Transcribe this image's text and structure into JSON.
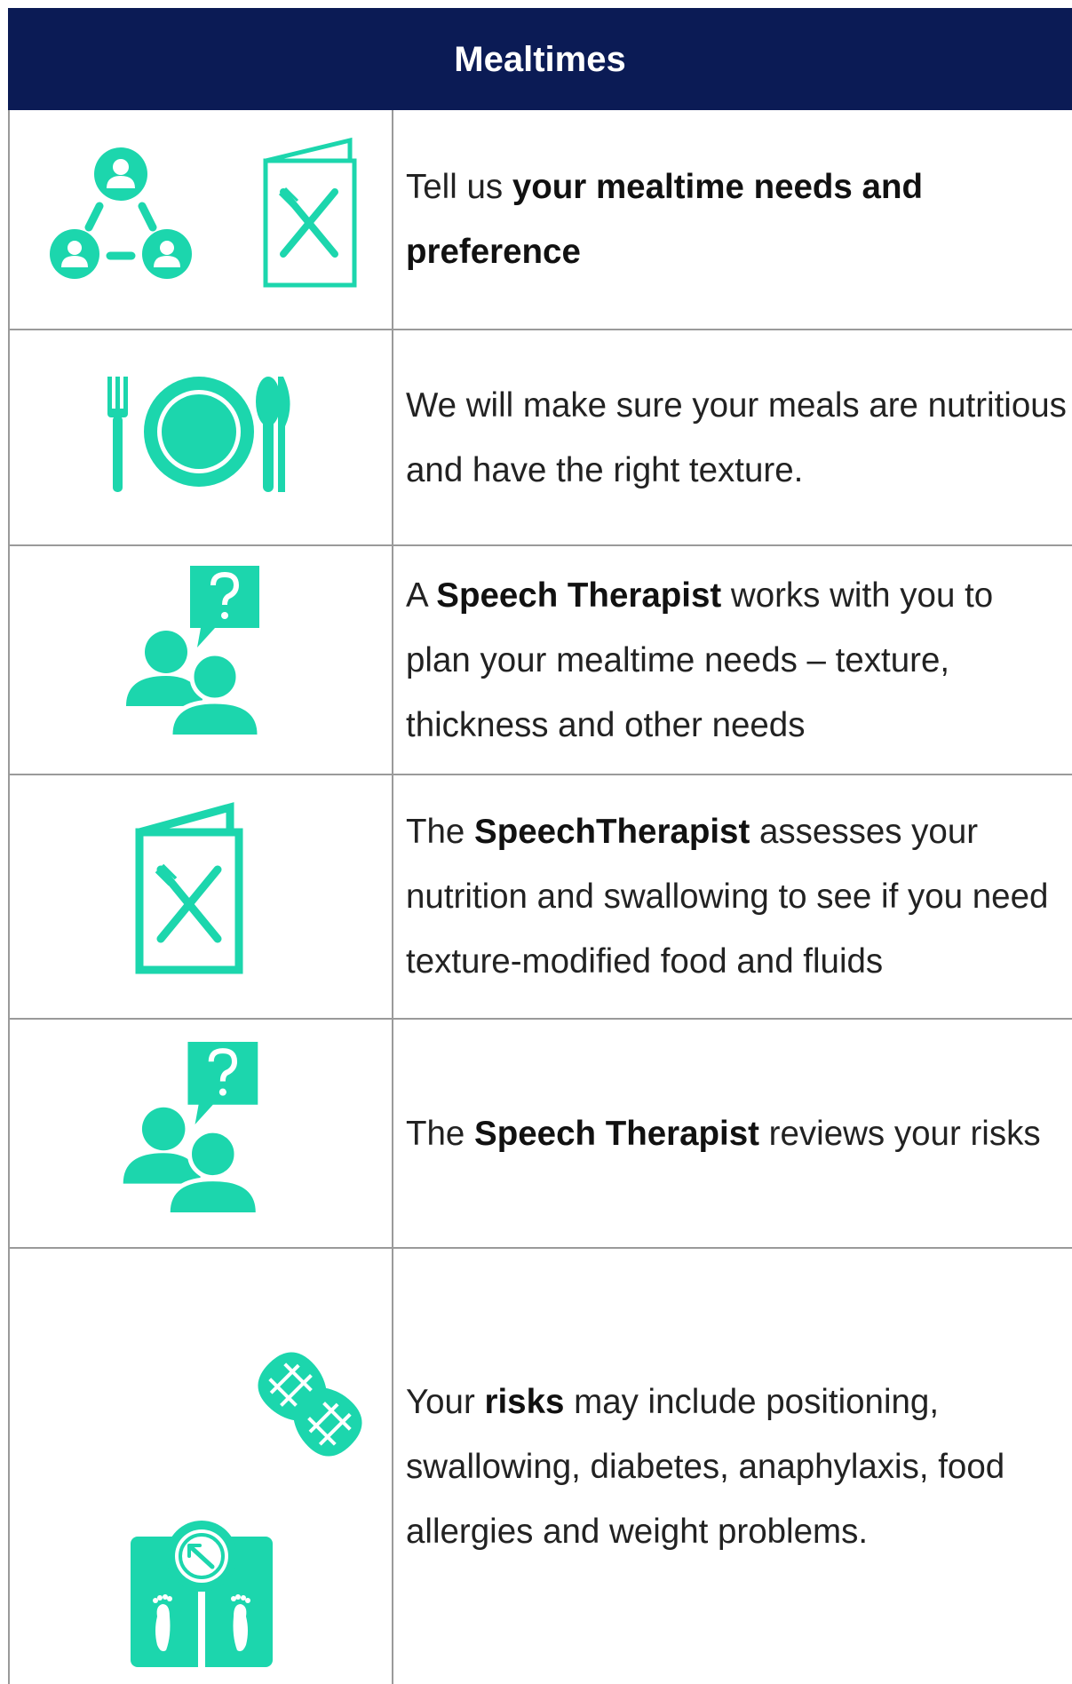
{
  "header": {
    "title": "Mealtimes"
  },
  "rows": [
    {
      "icons": [
        "people-network-icon",
        "menu-card-icon"
      ],
      "text": {
        "p1": "Tell us ",
        "b1": "your mealtime needs and preference",
        "p2": ""
      }
    },
    {
      "icons": [
        "plate-cutlery-icon"
      ],
      "text": {
        "p1": "We will make sure your meals are nutritious and have the right texture."
      }
    },
    {
      "icons": [
        "people-question-icon"
      ],
      "text": {
        "p1": "A ",
        "b1": "Speech Therapist",
        "p2": " works with you to plan your mealtime needs – texture, thickness and other needs"
      }
    },
    {
      "icons": [
        "menu-card-icon"
      ],
      "text": {
        "p1": "The ",
        "b1": "SpeechTherapist",
        "p2": " assesses your nutrition and swallowing to see if you need texture-modified food and fluids"
      }
    },
    {
      "icons": [
        "people-question-icon"
      ],
      "text": {
        "p1": "The ",
        "b1": "Speech Therapist",
        "p2": " reviews your risks"
      }
    },
    {
      "icons": [
        "peanut-icon",
        "weight-scale-icon"
      ],
      "text": {
        "p1": "Your ",
        "b1": "risks",
        "p2": " may include positioning, swallowing, diabetes, anaphylaxis, food allergies and weight problems."
      }
    }
  ],
  "colors": {
    "header_bg": "#0b1b55",
    "icon": "#1cd6ad",
    "border": "#9a9a9a"
  }
}
